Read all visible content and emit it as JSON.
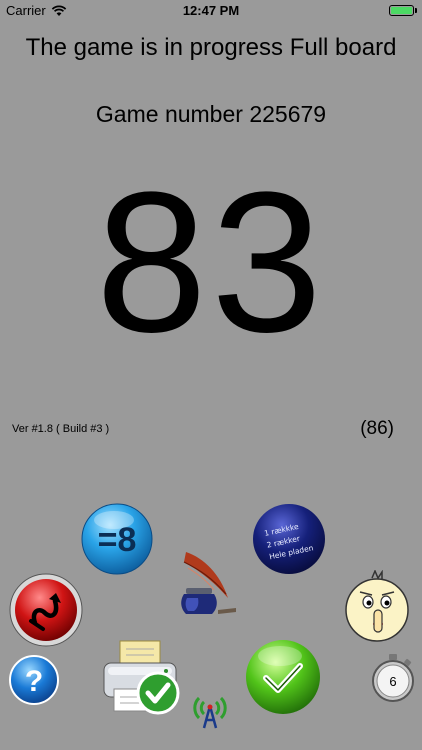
{
  "status_bar": {
    "carrier": "Carrier",
    "time": "12:47 PM",
    "battery_level": 1.0,
    "battery_color": "#4cd964",
    "icons": [
      "wifi-icon",
      "battery-icon"
    ]
  },
  "game": {
    "status": "The game is in progress Full board",
    "number_label": "Game number 225679",
    "current_number": "83",
    "version": "Ver #1.8 ( Build #3 )",
    "count": "(86)"
  },
  "buttons": {
    "equals8_label": "=8",
    "stopwatch_label": "6",
    "pattern_button_lines": [
      "1 rækkke",
      "2 rækker",
      "Hele pladen"
    ]
  },
  "colors": {
    "background": "#9a9a9a",
    "blue_button": "#2aa4e8",
    "navy_button": "#15207a",
    "red_button": "#d01414",
    "green_button": "#52c41a"
  }
}
